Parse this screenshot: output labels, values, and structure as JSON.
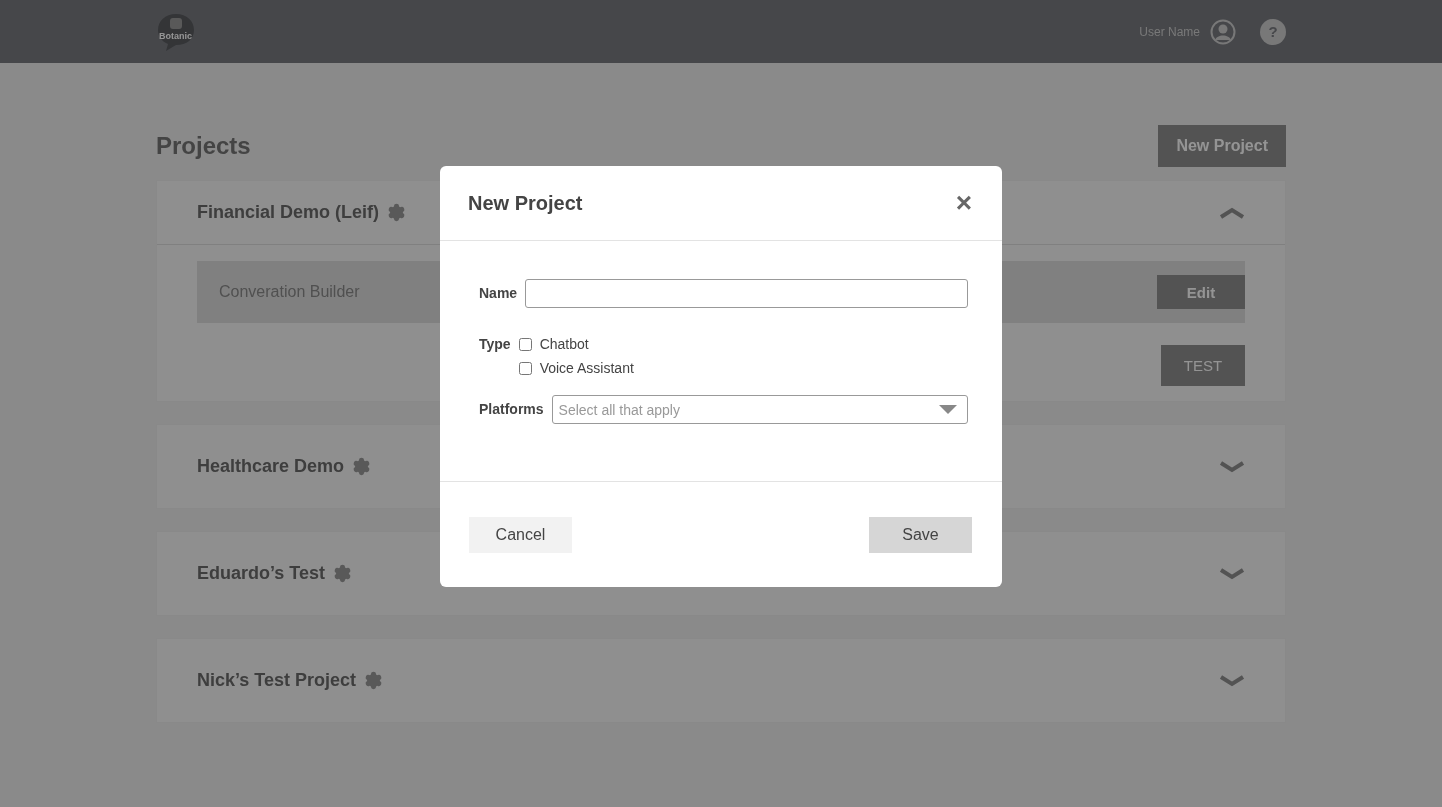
{
  "header": {
    "logo_text": "Botanic",
    "user_name": "User Name",
    "help": "?"
  },
  "page": {
    "title": "Projects",
    "new_button": "New Project"
  },
  "projects": [
    {
      "name": "Financial Demo (Leif)",
      "expanded": true,
      "items": [
        {
          "name": "Converation Builder",
          "button": "Edit"
        }
      ],
      "test_button": "TEST"
    },
    {
      "name": "Healthcare Demo",
      "expanded": false
    },
    {
      "name": "Eduardo’s Test",
      "expanded": false
    },
    {
      "name": "Nick’s Test Project",
      "expanded": false
    }
  ],
  "dialog": {
    "title": "New Project",
    "close": "×",
    "name_label": "Name",
    "type_label": "Type",
    "types": [
      {
        "label": "Chatbot",
        "checked": false
      },
      {
        "label": "Voice Assistant",
        "checked": false
      }
    ],
    "platforms_label": "Platforms",
    "platforms_placeholder": "Select all that apply",
    "cancel": "Cancel",
    "save": "Save"
  }
}
